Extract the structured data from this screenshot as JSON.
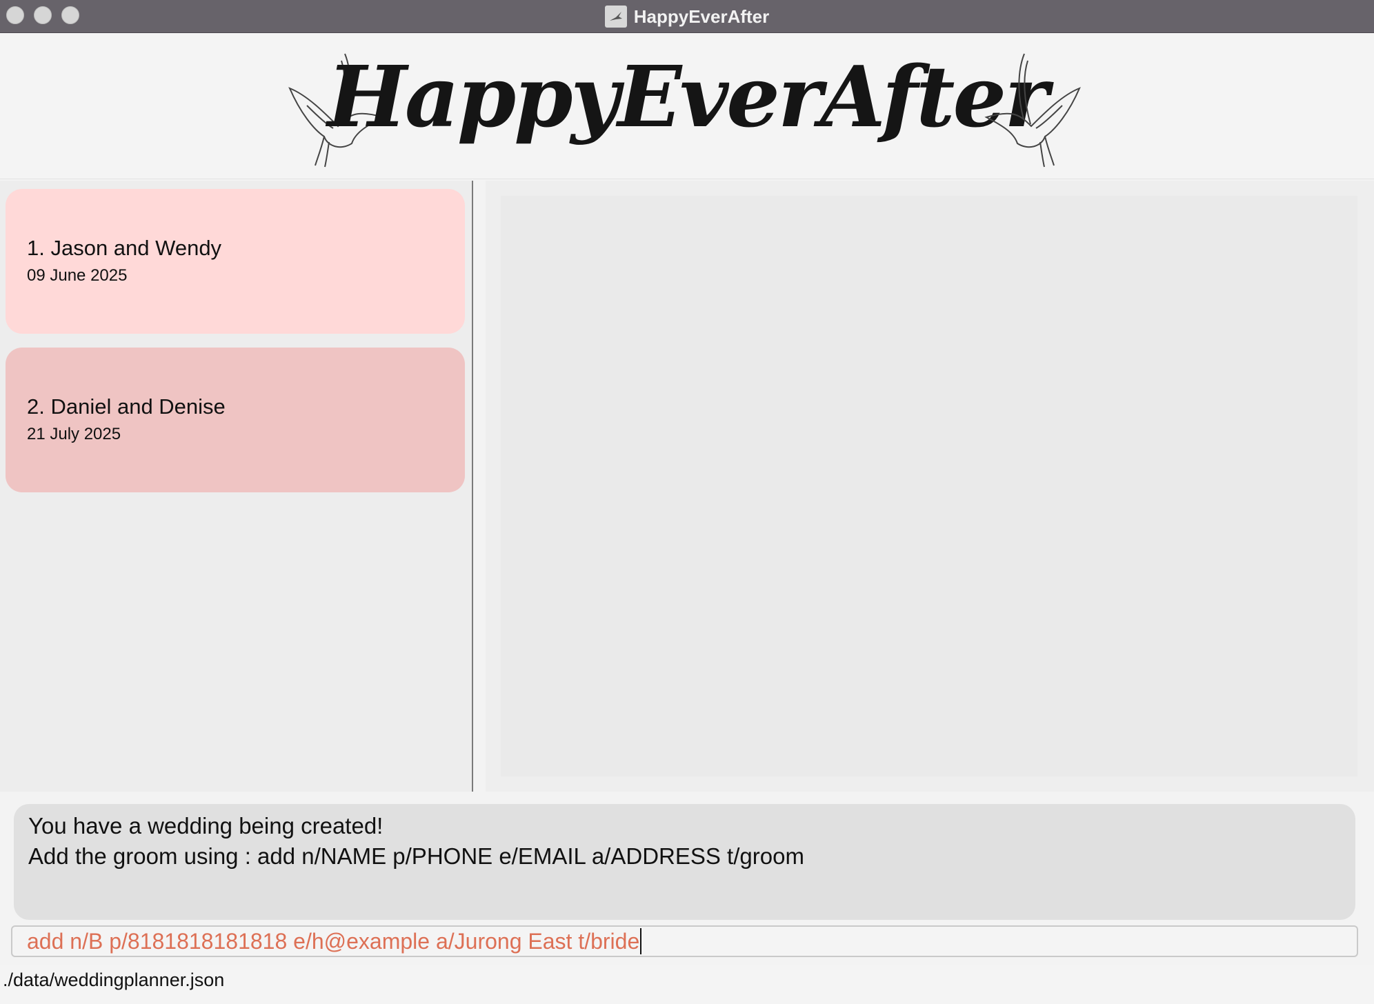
{
  "window": {
    "title": "HappyEverAfter",
    "icon": "app-bird-icon"
  },
  "header": {
    "logo_text": "HappyEverAfter"
  },
  "weddings": [
    {
      "title": "1. Jason and Wendy",
      "date": "09 June 2025",
      "color": "#ffd9d8"
    },
    {
      "title": "2. Daniel and Denise",
      "date": "21 July 2025",
      "color": "#efc4c3"
    }
  ],
  "result": {
    "line1": "You have a wedding being created!",
    "line2": "Add the groom using : add n/NAME p/PHONE e/EMAIL a/ADDRESS t/groom"
  },
  "command": {
    "value": "add n/B p/8181818181818 e/h@example a/Jurong East t/bride",
    "text_color": "#dd7055"
  },
  "status": {
    "file_path": "./data/weddingplanner.json"
  }
}
